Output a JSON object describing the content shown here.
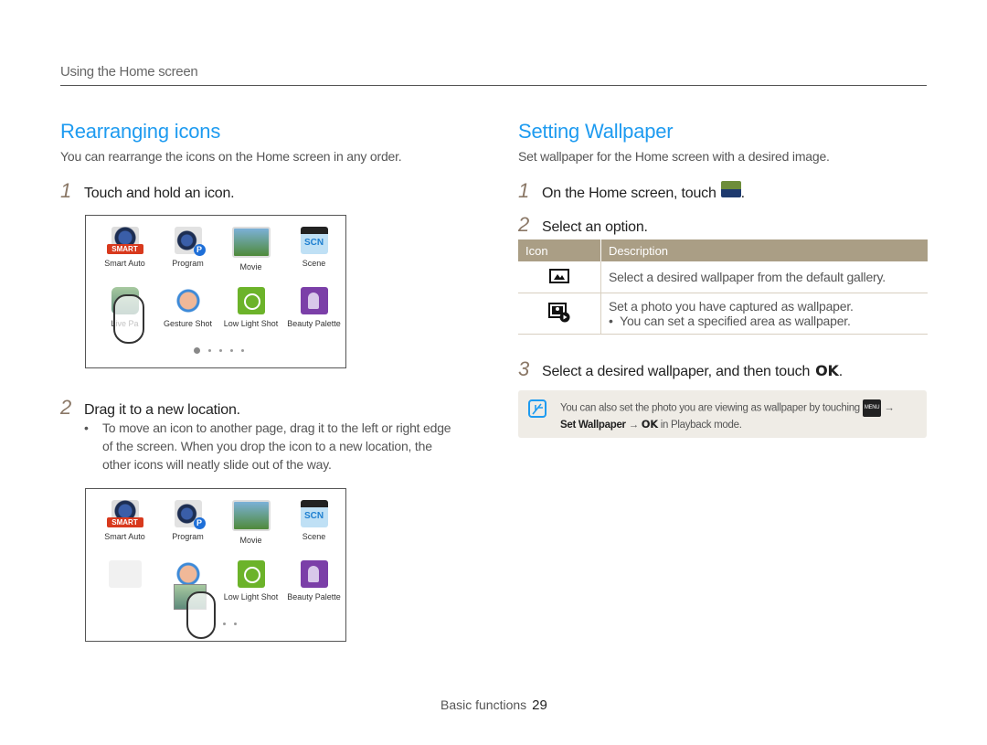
{
  "header": {
    "section": "Using the Home screen"
  },
  "left": {
    "title": "Rearranging icons",
    "intro": "You can rearrange the icons on the Home screen in any order.",
    "step1": {
      "num": "1",
      "text": "Touch and hold an icon."
    },
    "screen1": {
      "row1": [
        "Smart Auto",
        "Program",
        "Movie",
        "Scene"
      ],
      "row2": [
        "Live Pa",
        "Gesture Shot",
        "Low Light Shot",
        "Beauty Palette"
      ],
      "page_dots": 5,
      "active_page": 1
    },
    "step2": {
      "num": "2",
      "text": "Drag it to a new location."
    },
    "bullet": "To move an icon to another page, drag it to the left or right edge of the screen. When you drop the icon to a new location, the other icons will neatly slide out of the way.",
    "screen2": {
      "row1": [
        "Smart Auto",
        "Program",
        "Movie",
        "Scene"
      ],
      "row2": [
        "",
        "",
        "Low Light Shot",
        "Beauty Palette"
      ]
    }
  },
  "right": {
    "title": "Setting Wallpaper",
    "intro": "Set wallpaper for the Home screen with a desired image.",
    "step1": {
      "num": "1",
      "text": "On the Home screen, touch",
      "icon": "wallpaper-app-icon",
      "suffix": "."
    },
    "step2": {
      "num": "2",
      "text": "Select an option."
    },
    "table": {
      "headers": [
        "Icon",
        "Description"
      ],
      "rows": [
        {
          "icon": "gallery-icon",
          "text": "Select a desired wallpaper from the default gallery.",
          "bullet": ""
        },
        {
          "icon": "captured-photo-icon",
          "text": "Set a photo you have captured as wallpaper.",
          "bullet": "You can set a specified area as wallpaper."
        }
      ]
    },
    "step3": {
      "num": "3",
      "text": "Select a desired wallpaper, and then touch",
      "ok": "OK",
      "suffix": "."
    },
    "note": {
      "line1": "You can also set the photo you are viewing as wallpaper by touching",
      "menu_label": "MENU",
      "arrow": "→",
      "set_wallpaper": "Set Wallpaper",
      "ok": "OK",
      "line2_suffix": "in Playback mode."
    }
  },
  "footer": {
    "label": "Basic functions",
    "page": "29"
  },
  "colors": {
    "accent": "#1e9bf0",
    "table_header": "#aa9e85",
    "note_bg": "#efece6",
    "step_num": "#8a7766"
  }
}
